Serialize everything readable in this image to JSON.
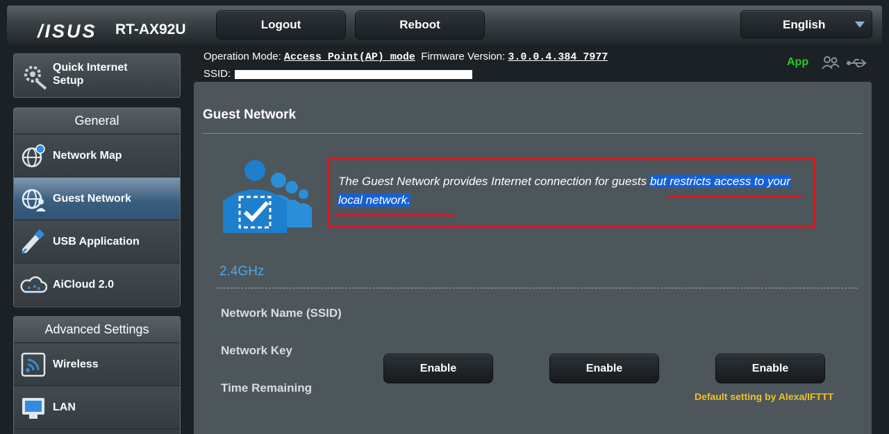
{
  "header": {
    "brand": "/ISUS",
    "model": "RT-AX92U",
    "logout_label": "Logout",
    "reboot_label": "Reboot",
    "language": "English"
  },
  "status": {
    "op_mode_label": "Operation Mode:",
    "op_mode_value": "Access Point(AP) mode",
    "firmware_label": "Firmware Version:",
    "firmware_value": "3.0.0.4.384_7977",
    "ssid_label": "SSID:",
    "app_label": "App"
  },
  "sidebar": {
    "quick_setup": "Quick Internet Setup",
    "general_title": "General",
    "general_items": [
      {
        "label": "Network Map",
        "icon": "globe-pin-icon"
      },
      {
        "label": "Guest Network",
        "icon": "globe-people-icon"
      },
      {
        "label": "USB Application",
        "icon": "usb-icon"
      },
      {
        "label": "AiCloud 2.0",
        "icon": "cloud-icon"
      }
    ],
    "advanced_title": "Advanced Settings",
    "advanced_items": [
      {
        "label": "Wireless",
        "icon": "wireless-icon"
      },
      {
        "label": "LAN",
        "icon": "lan-icon"
      }
    ]
  },
  "main": {
    "title": "Guest Network",
    "description_plain": "The Guest Network provides Internet connection for guests ",
    "description_highlight": "but restricts access to your local network.",
    "band": "2.4GHz",
    "rows": [
      "Network Name (SSID)",
      "Network Key",
      "Time Remaining"
    ],
    "enable_label": "Enable",
    "alexa_note": "Default setting by Alexa/IFTTT"
  },
  "colors": {
    "accent_blue": "#4fa6e6",
    "highlight": "#1560d6",
    "annotation_red": "#e0141c",
    "app_green": "#2ec82e",
    "note_yellow": "#f5c21b"
  }
}
